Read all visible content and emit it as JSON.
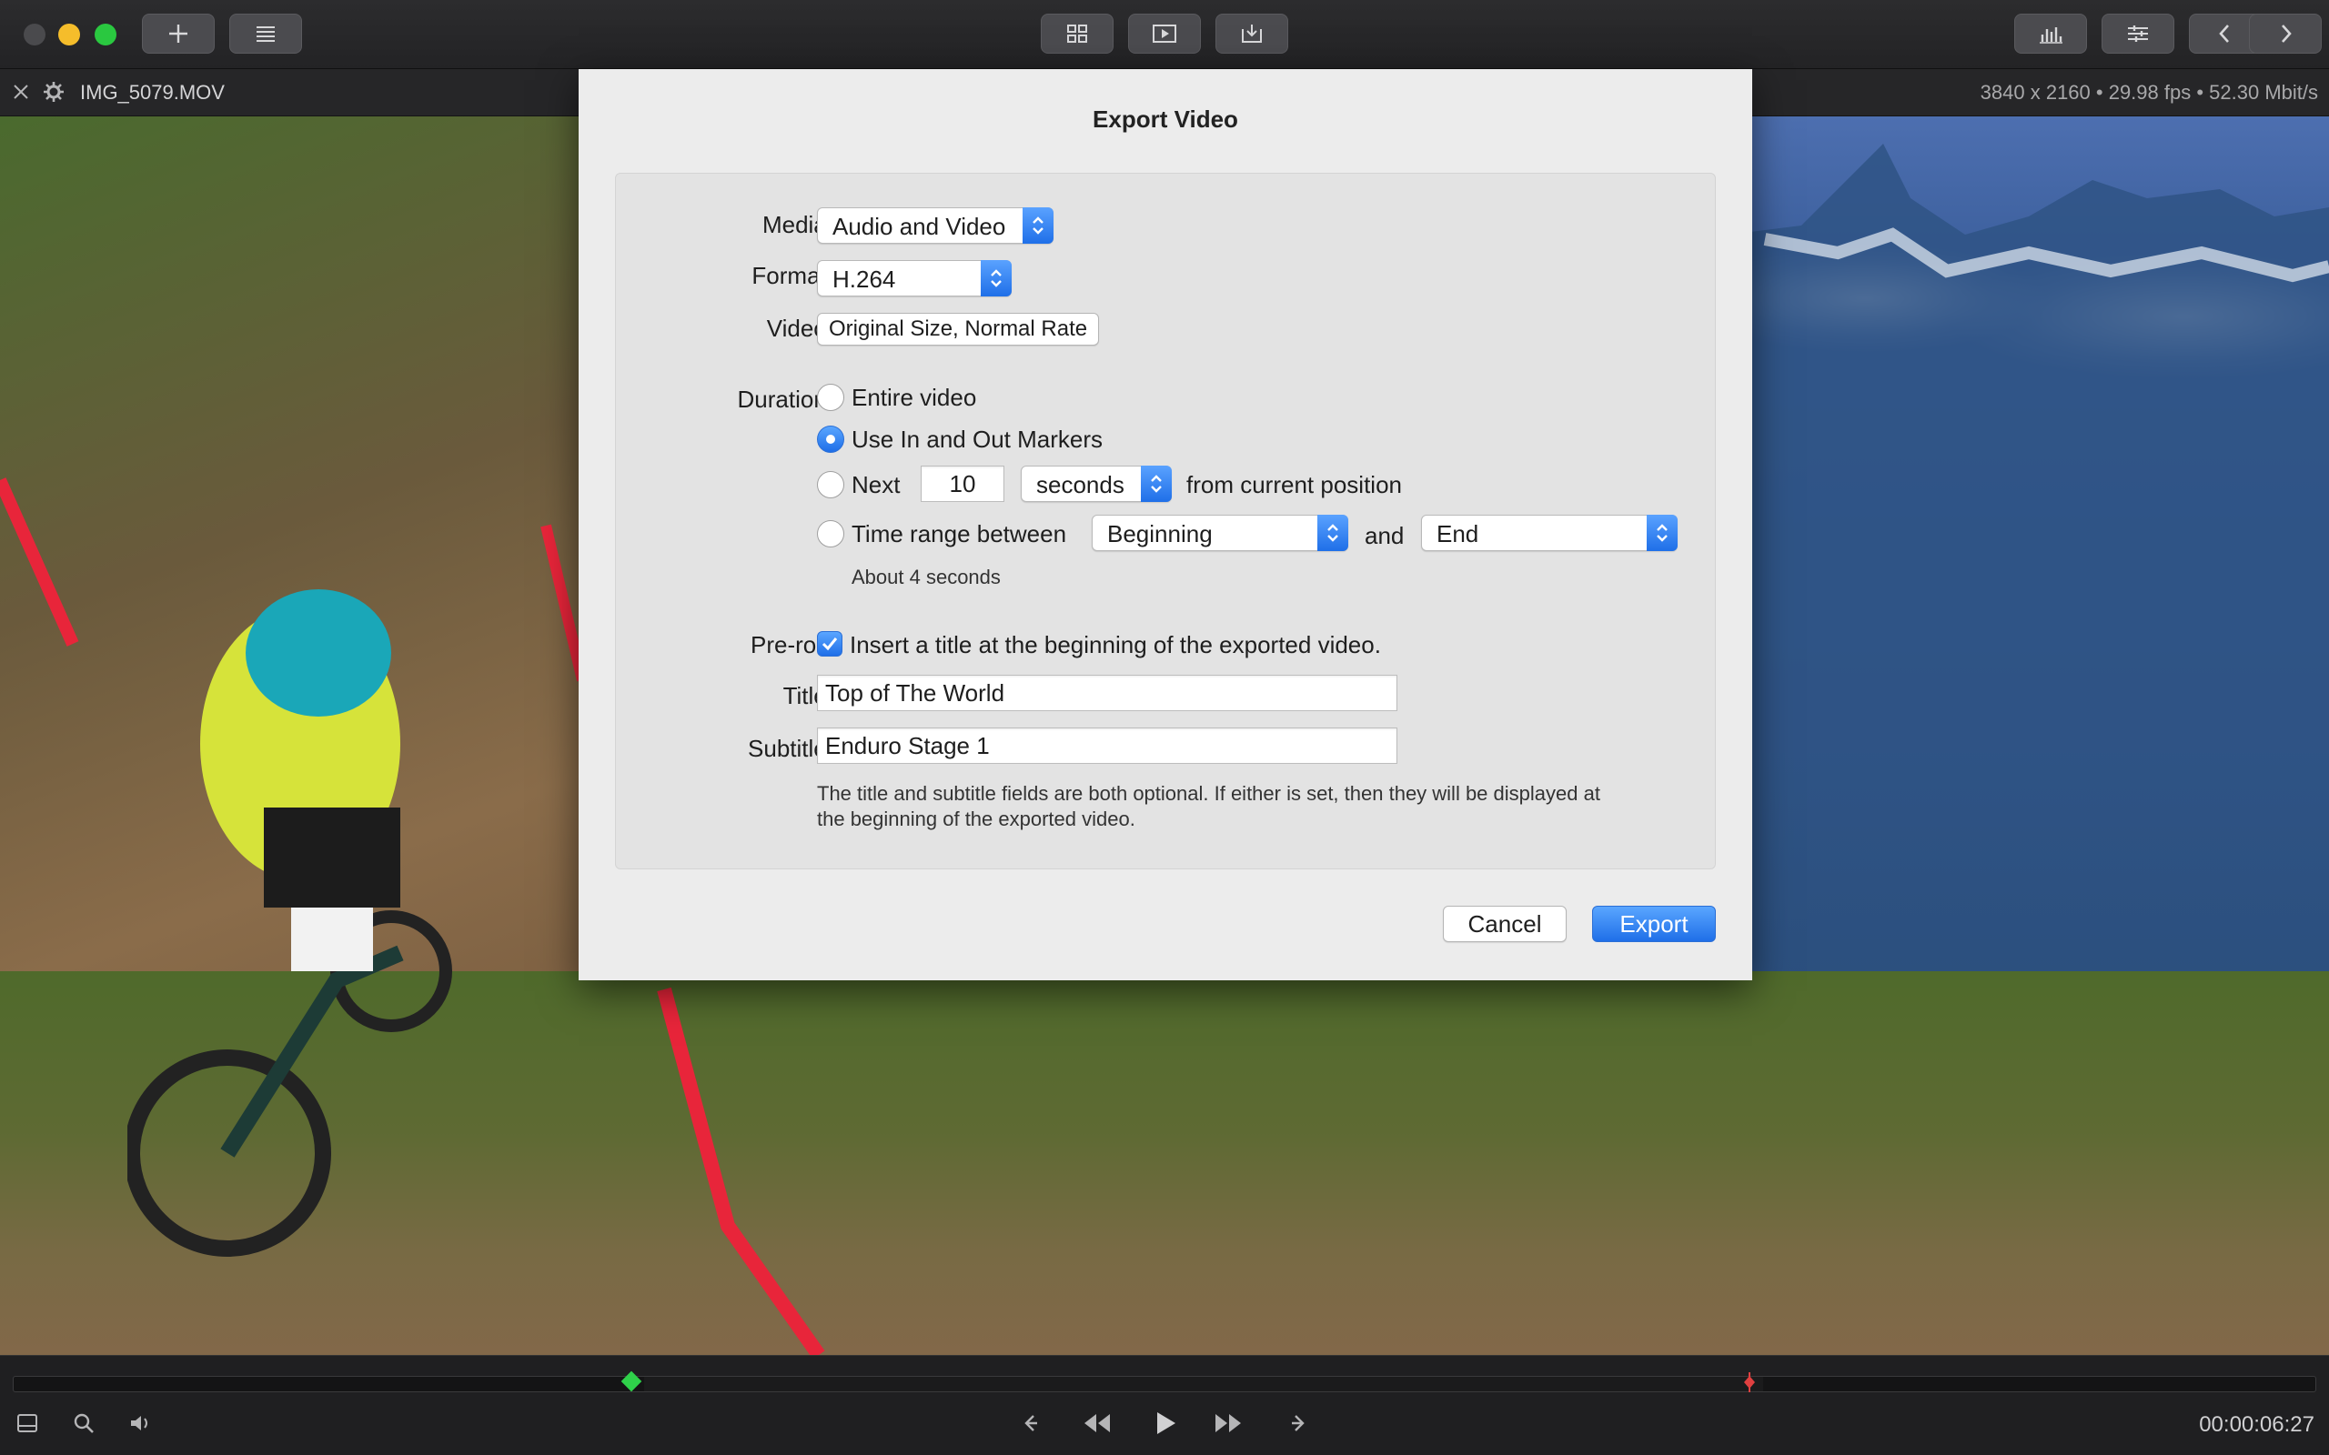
{
  "file": {
    "name": "IMG_5079.MOV",
    "meta": "3840 x 2160 • 29.98 fps • 52.30 Mbit/s"
  },
  "dialog": {
    "title": "Export Video",
    "media_label": "Media:",
    "media_value": "Audio and Video",
    "format_label": "Format:",
    "format_value": "H.264",
    "video_label": "Video:",
    "video_button": "Original Size, Normal Rate",
    "duration_label": "Duration:",
    "option_entire": "Entire video",
    "option_markers": "Use In and Out Markers",
    "option_next": "Next",
    "next_value": "10",
    "next_unit": "seconds",
    "next_suffix": "from current position",
    "option_range": "Time range between",
    "range_start": "Beginning",
    "range_and": "and",
    "range_end": "End",
    "duration_note": "About 4 seconds",
    "preroll_label": "Pre-roll:",
    "preroll_text": "Insert a title at the beginning of the exported video.",
    "title_label": "Title:",
    "title_value": "Top of The World",
    "subtitle_label": "Subtitle:",
    "subtitle_value": "Enduro Stage 1",
    "help_line1": "The title and subtitle fields are both optional. If either is set, then they will be displayed at",
    "help_line2": "the beginning of the exported video.",
    "cancel_label": "Cancel",
    "export_label": "Export"
  },
  "timeline": {
    "timecode": "00:00:06:27"
  },
  "colors": {
    "accent": "#1f6fe8",
    "in_marker": "#2fd14a",
    "out_marker": "#e04040"
  }
}
